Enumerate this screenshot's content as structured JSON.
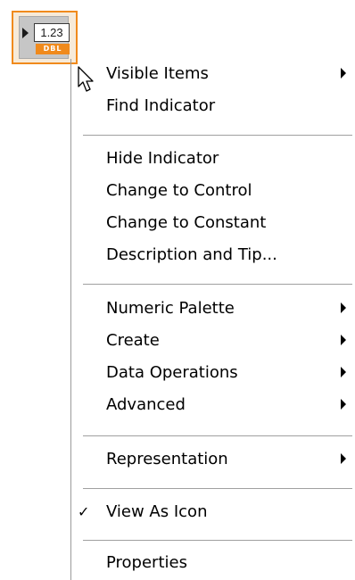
{
  "indicator": {
    "value": "1.23",
    "type_label": "DBL",
    "accent_color": "#f08a1c"
  },
  "menu": {
    "items": [
      {
        "label": "Visible Items",
        "submenu": true,
        "checked": false
      },
      {
        "label": "Find Indicator",
        "submenu": false,
        "checked": false
      },
      {
        "label": "Hide Indicator",
        "submenu": false,
        "checked": false
      },
      {
        "label": "Change to Control",
        "submenu": false,
        "checked": false
      },
      {
        "label": "Change to Constant",
        "submenu": false,
        "checked": false
      },
      {
        "label": "Description and Tip...",
        "submenu": false,
        "checked": false
      },
      {
        "label": "Numeric Palette",
        "submenu": true,
        "checked": false
      },
      {
        "label": "Create",
        "submenu": true,
        "checked": false
      },
      {
        "label": "Data Operations",
        "submenu": true,
        "checked": false
      },
      {
        "label": "Advanced",
        "submenu": true,
        "checked": false
      },
      {
        "label": "Representation",
        "submenu": true,
        "checked": false
      },
      {
        "label": "View As Icon",
        "submenu": false,
        "checked": true
      },
      {
        "label": "Properties",
        "submenu": false,
        "checked": false
      }
    ],
    "check_glyph": "✓",
    "cursor_icon": "arrow-pointer-icon"
  }
}
